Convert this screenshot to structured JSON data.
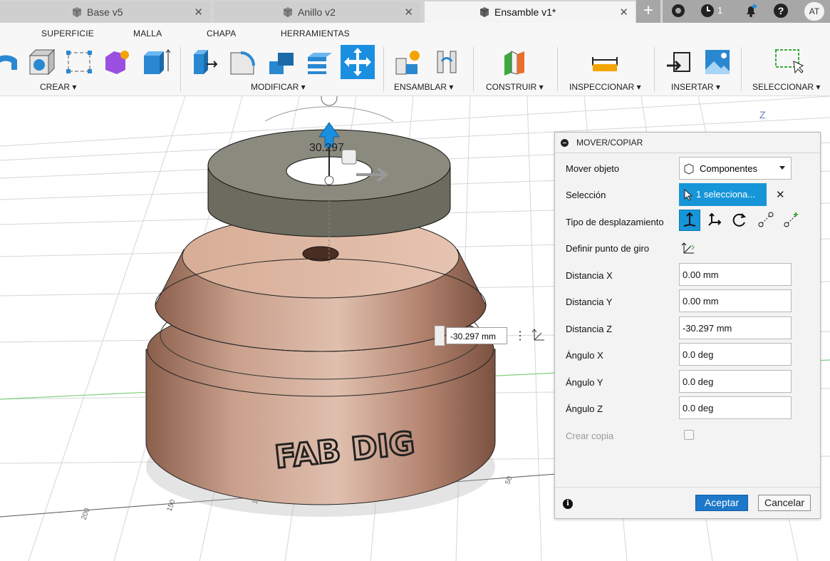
{
  "tabs": [
    {
      "label": "Base v5"
    },
    {
      "label": "Anillo v2"
    },
    {
      "label": "Ensamble v1*"
    }
  ],
  "header": {
    "plus": "+",
    "count": "1",
    "avatar": "AT"
  },
  "ribbon": {
    "tabs": [
      "SUPERFICIE",
      "MALLA",
      "CHAPA",
      "HERRAMIENTAS"
    ],
    "groups": [
      "CREAR ▾",
      "MODIFICAR ▾",
      "ENSAMBLAR ▾",
      "CONSTRUIR ▾",
      "INSPECCIONAR ▾",
      "INSERTAR ▾",
      "SELECCIONAR ▾"
    ]
  },
  "viewport": {
    "dim_label": "30.297",
    "dim_input": "-30.297 mm",
    "axis_label": "Z",
    "engraving": "FAB DIG",
    "ruler": [
      "200",
      "150",
      "100",
      "50"
    ]
  },
  "panel": {
    "title": "MOVER/COPIAR",
    "rows": {
      "mover": "Mover objeto",
      "seleccion": "Selección",
      "tipo": "Tipo de desplazamiento",
      "pivote": "Definir punto de giro",
      "dx": "Distancia X",
      "dy": "Distancia Y",
      "dz": "Distancia Z",
      "ax": "Ángulo X",
      "ay": "Ángulo Y",
      "az": "Ángulo Z",
      "copia": "Crear copia"
    },
    "values": {
      "mover": "Componentes",
      "seleccion": "1 selecciona...",
      "dx": "0.00 mm",
      "dy": "0.00 mm",
      "dz": "-30.297 mm",
      "ax": "0.0 deg",
      "ay": "0.0 deg",
      "az": "0.0 deg"
    },
    "ok": "Aceptar",
    "cancel": "Cancelar"
  }
}
